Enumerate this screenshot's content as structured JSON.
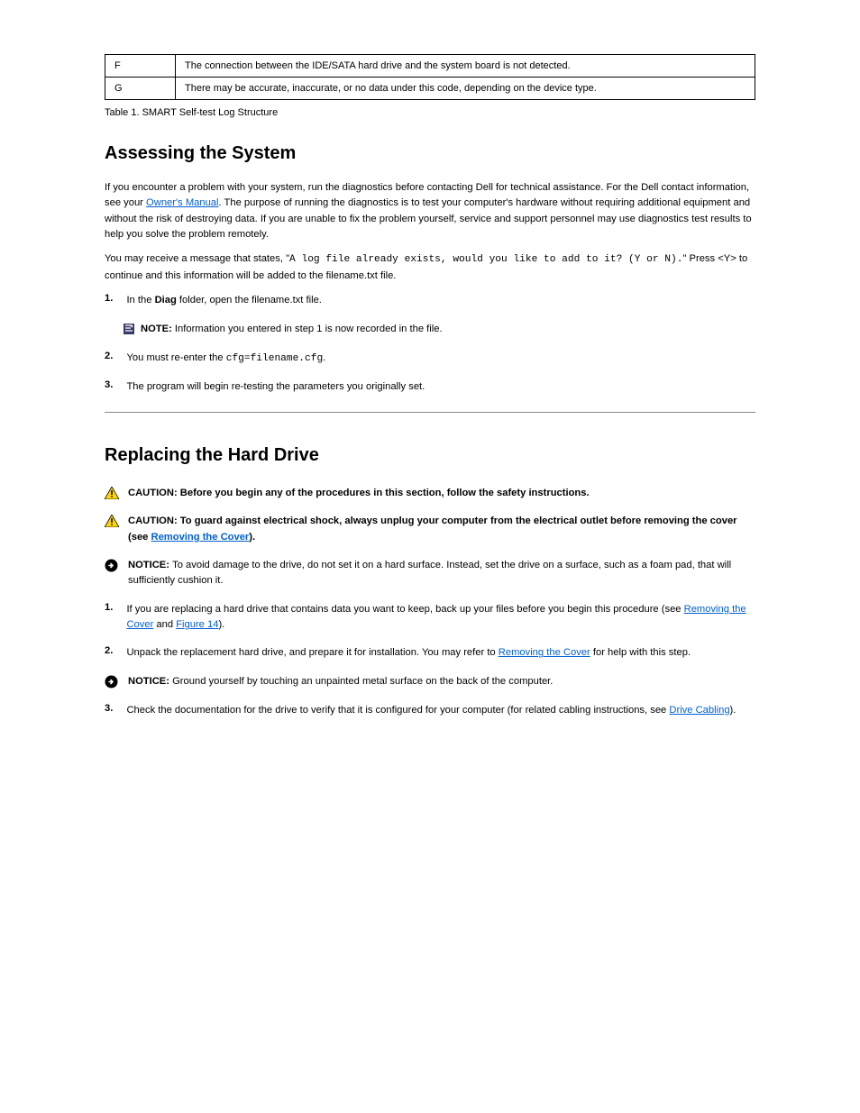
{
  "table": {
    "row1": {
      "code": "F",
      "desc": "The connection between the IDE/SATA hard drive and the system board is not detected."
    },
    "row2": {
      "code": "G",
      "desc": "There may be accurate, inaccurate, or no data under this code, depending on the device type."
    }
  },
  "caption": "Table 1. SMART Self-test Log Structure",
  "assess_heading": "Assessing the System",
  "assess_p1_a": "If you encounter a problem with your system, run the diagnostics before contacting Dell for technical assistance. For the Dell contact information, see your ",
  "assess_p1_link": "Owner's Manual",
  "assess_p1_b": ". The purpose of running the diagnostics is to test your computer's hardware without requiring additional equipment and without the risk of destroying data. If you are unable to fix the problem yourself, service and support personnel may use diagnostics test results to help you solve the problem remotely.",
  "assess_p2_a": "You may receive a message that states, \"",
  "assess_p2_mono": "A log file already exists, would you like to add to it? (Y or N).",
  "assess_p2_b": "\" Press <Y> to continue and this information will be added to the ",
  "assess_p2_file": "filename.txt",
  "assess_p2_c": " file.",
  "step1_num": "1.",
  "step1_a": "In the ",
  "step1_b": "Diag",
  "step1_c": " folder, open the ",
  "step1_file": "filename.txt",
  "step1_d": " file.",
  "note_label": "NOTE: ",
  "note_text": "Information you entered in step 1 is now recorded in the file.",
  "step2_num": "2.",
  "step2_a": "You must re-enter the ",
  "step2_mono": "cfg=filename.cfg",
  "step2_b": ".",
  "step3_num": "3.",
  "step3_text": "The program will begin re-testing the parameters you originally set.",
  "hr_present": true,
  "repl_heading": "Replacing the Hard Drive",
  "caution1_label": "CAUTION: ",
  "caution1_text": "Before you begin any of the procedures in this section, follow the safety instructions.",
  "caution2_label": "CAUTION: ",
  "caution2_a": "To guard against electrical shock, always unplug your computer from the electrical outlet before removing the cover (see ",
  "caution2_link": "Removing the Cover",
  "caution2_b": ").",
  "notice1_label": "NOTICE: ",
  "notice1_text": "To avoid damage to the drive, do not set it on a hard surface. Instead, set the drive on a surface, such as a foam pad, that will sufficiently cushion it.",
  "repl_step1_num": "1.",
  "repl_step1_a": "If you are replacing a hard drive that contains data you want to keep, back up your files before you begin this procedure (see ",
  "repl_step1_link1": "Removing the Cover",
  "repl_step1_b": " and ",
  "repl_step1_link2": "Figure 14",
  "repl_step1_c": ").",
  "repl_step2_num": "2.",
  "repl_step2_a": "Unpack the replacement hard drive, and prepare it for installation. You may refer to ",
  "repl_step2_link": "Removing the Cover",
  "repl_step2_b": " for help with this step.",
  "notice2_label": "NOTICE: ",
  "notice2_text": "Ground yourself by touching an unpainted metal surface on the back of the computer.",
  "repl_step3_num": "3.",
  "repl_step3_a": "Check the documentation for the drive to verify that it is configured for your computer (for related cabling instructions, see ",
  "repl_step3_link": "Drive Cabling",
  "repl_step3_b": ")."
}
